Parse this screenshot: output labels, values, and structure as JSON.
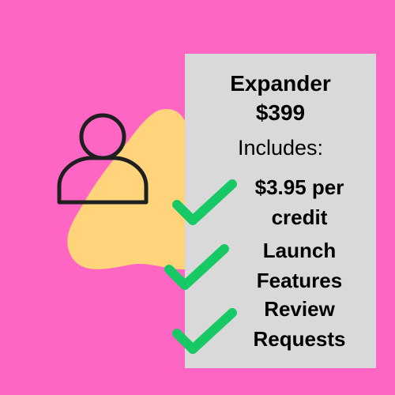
{
  "plan": {
    "name": "Expander",
    "price": "$399",
    "includes_label": "Includes:"
  },
  "features": [
    {
      "line1": "$3.95 per",
      "line2": "credit"
    },
    {
      "line1": "Launch",
      "line2": "Features"
    },
    {
      "line1": "Review",
      "line2": "Requests"
    }
  ],
  "colors": {
    "background": "#ff66c4",
    "blob": "#ffd47a",
    "card": "#d9d9d9",
    "check": "#17c964",
    "icon_stroke": "#1f1f1f"
  },
  "icons": [
    "user-icon",
    "checkmark-icon"
  ]
}
